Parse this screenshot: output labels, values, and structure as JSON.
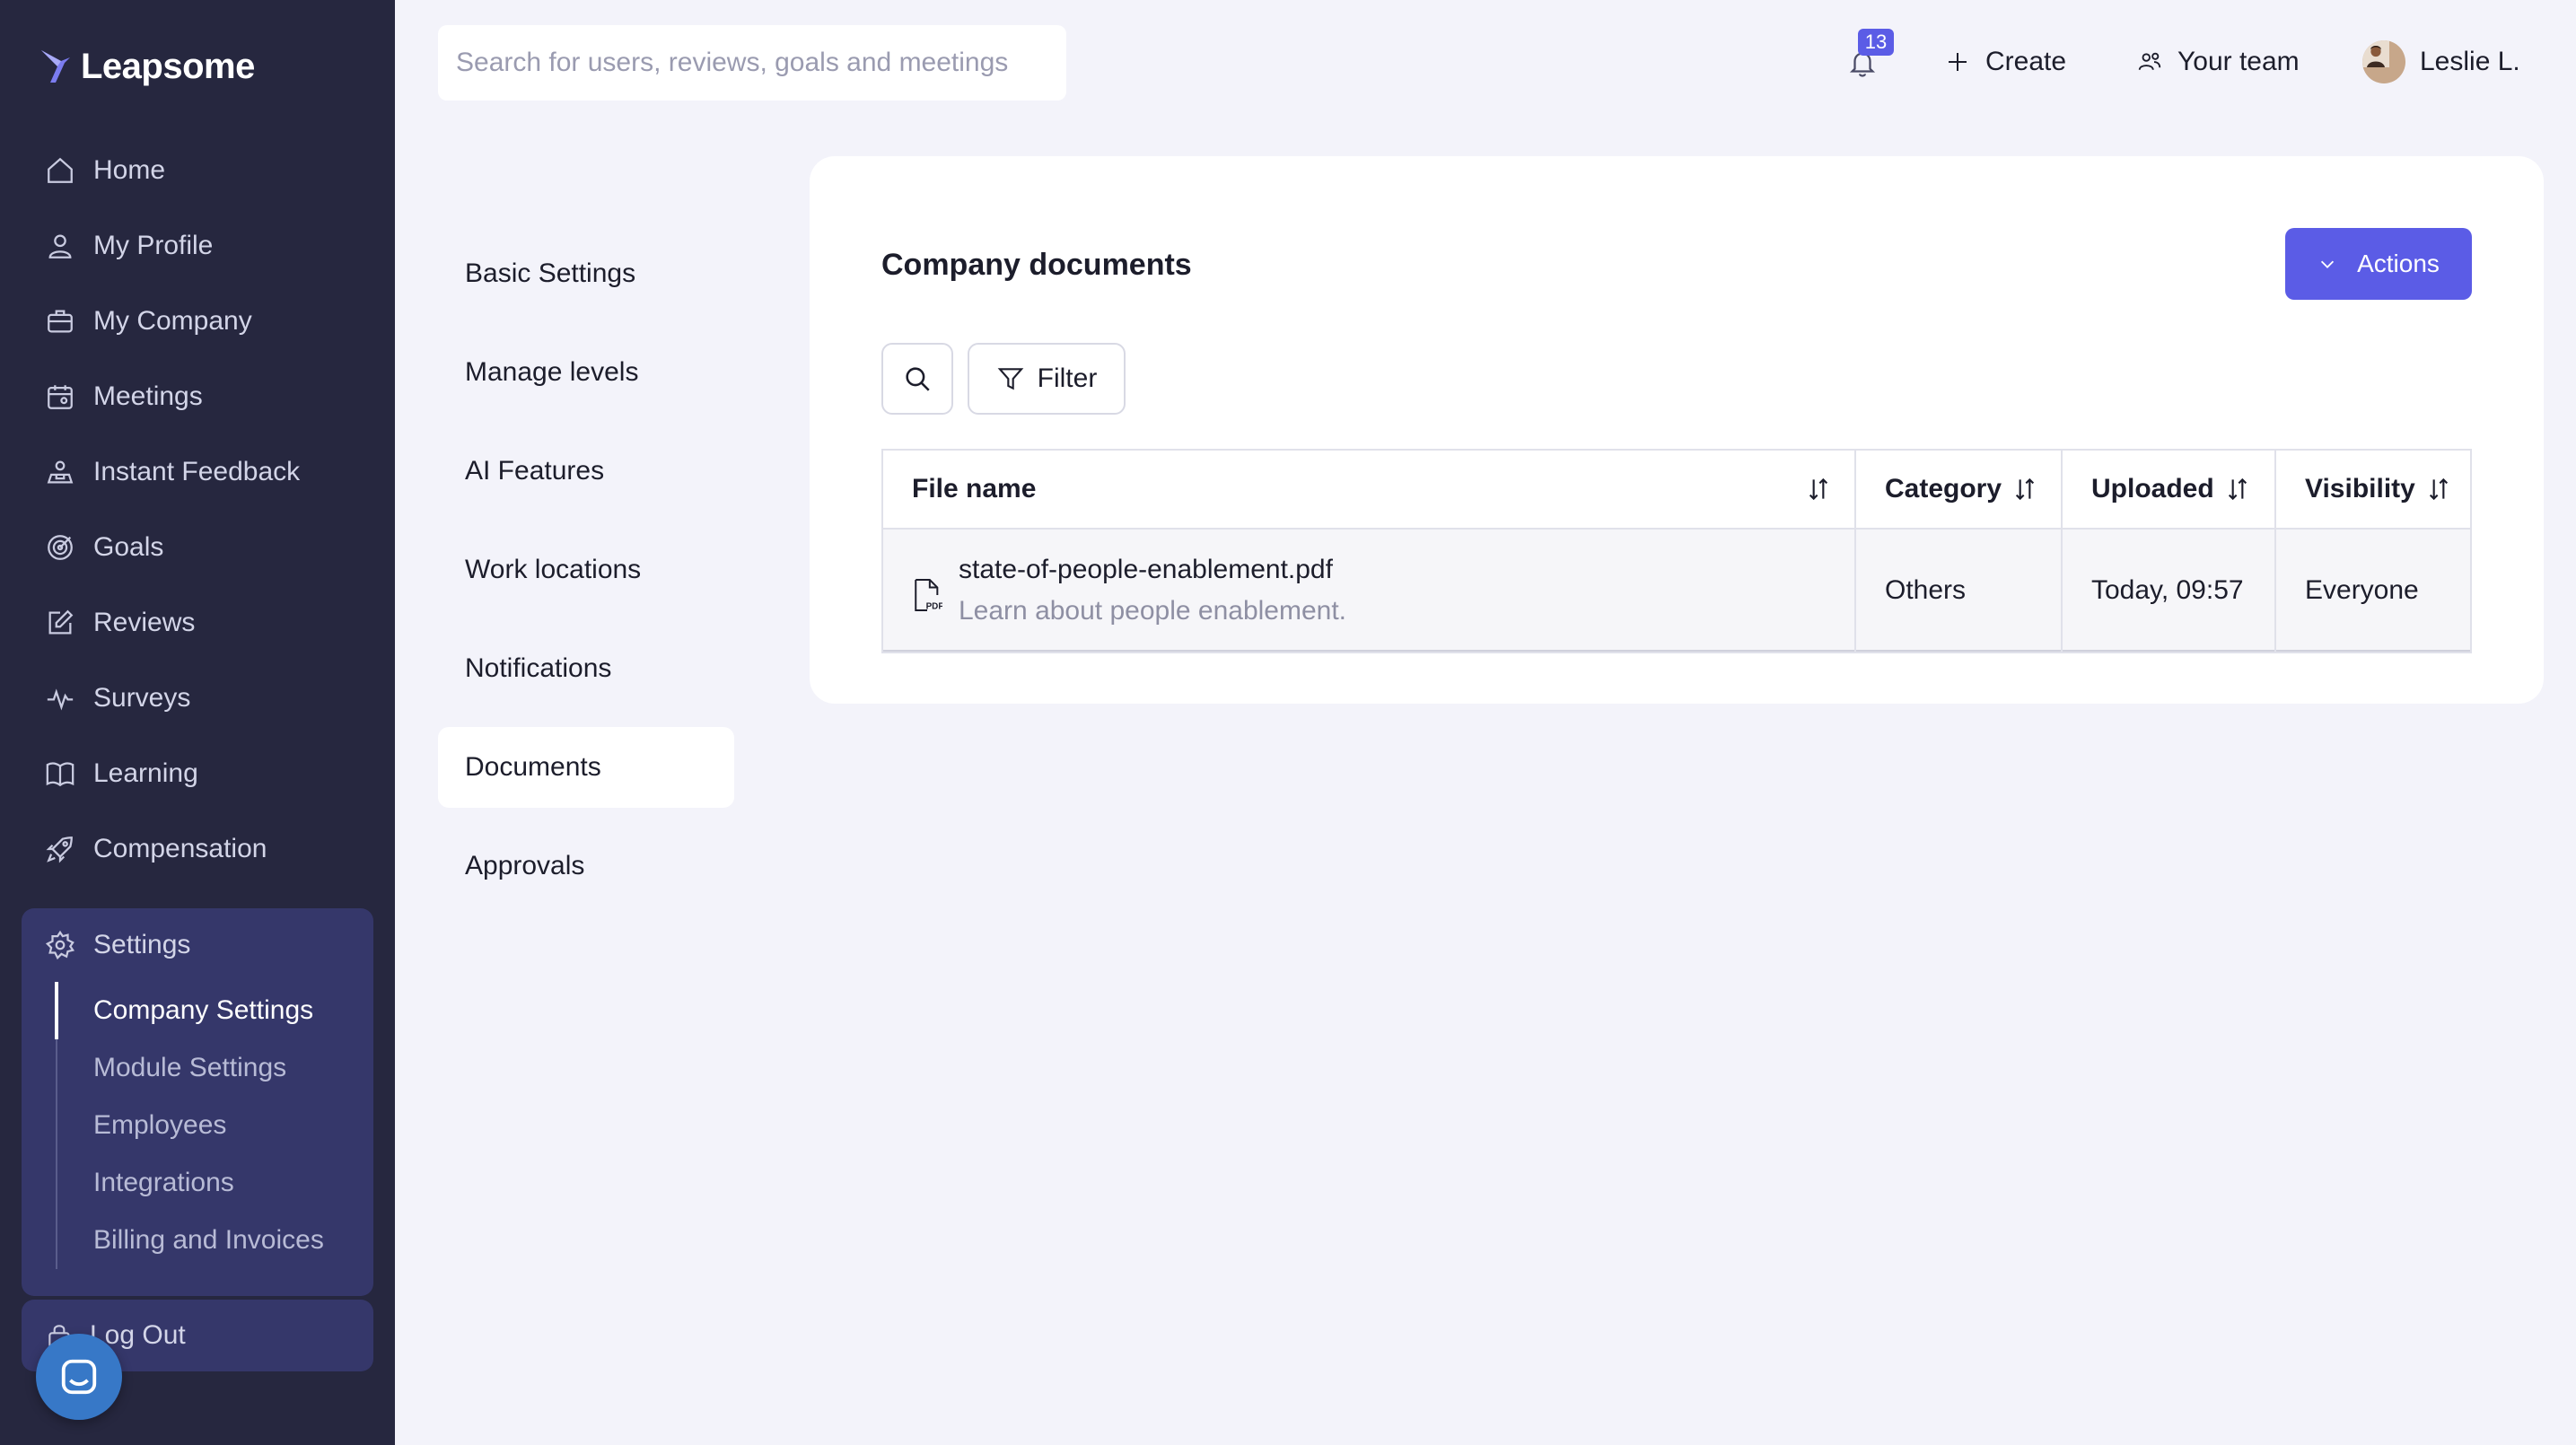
{
  "app": {
    "name": "Leapsome"
  },
  "sidebar": {
    "items": [
      {
        "label": "Home",
        "icon": "home-icon"
      },
      {
        "label": "My Profile",
        "icon": "user-icon"
      },
      {
        "label": "My Company",
        "icon": "briefcase-icon"
      },
      {
        "label": "Meetings",
        "icon": "calendar-icon"
      },
      {
        "label": "Instant Feedback",
        "icon": "feedback-icon"
      },
      {
        "label": "Goals",
        "icon": "target-icon"
      },
      {
        "label": "Reviews",
        "icon": "edit-icon"
      },
      {
        "label": "Surveys",
        "icon": "pulse-icon"
      },
      {
        "label": "Learning",
        "icon": "book-icon"
      },
      {
        "label": "Compensation",
        "icon": "rocket-icon"
      }
    ],
    "settings": {
      "label": "Settings",
      "sub_items": [
        "Company Settings",
        "Module Settings",
        "Employees",
        "Integrations",
        "Billing and Invoices"
      ]
    },
    "logout": "Log Out"
  },
  "topbar": {
    "search_placeholder": "Search for users, reviews, goals and meetings",
    "notification_count": "13",
    "create_label": "Create",
    "team_label": "Your team",
    "user_name": "Leslie L."
  },
  "settings_nav": {
    "items": [
      "Basic Settings",
      "Manage levels",
      "AI Features",
      "Work locations",
      "Notifications",
      "Documents",
      "Approvals"
    ],
    "active": "Documents"
  },
  "documents": {
    "title": "Company documents",
    "actions_label": "Actions",
    "filter_label": "Filter",
    "columns": [
      "File name",
      "Category",
      "Uploaded",
      "Visibility"
    ],
    "rows": [
      {
        "file_name": "state-of-people-enablement.pdf",
        "description": "Learn about people enablement.",
        "category": "Others",
        "uploaded": "Today, 09:57",
        "visibility": "Everyone"
      }
    ]
  },
  "colors": {
    "sidebar_bg": "#26273f",
    "accent": "#5b5ce6",
    "page_bg": "#f3f3fa"
  }
}
